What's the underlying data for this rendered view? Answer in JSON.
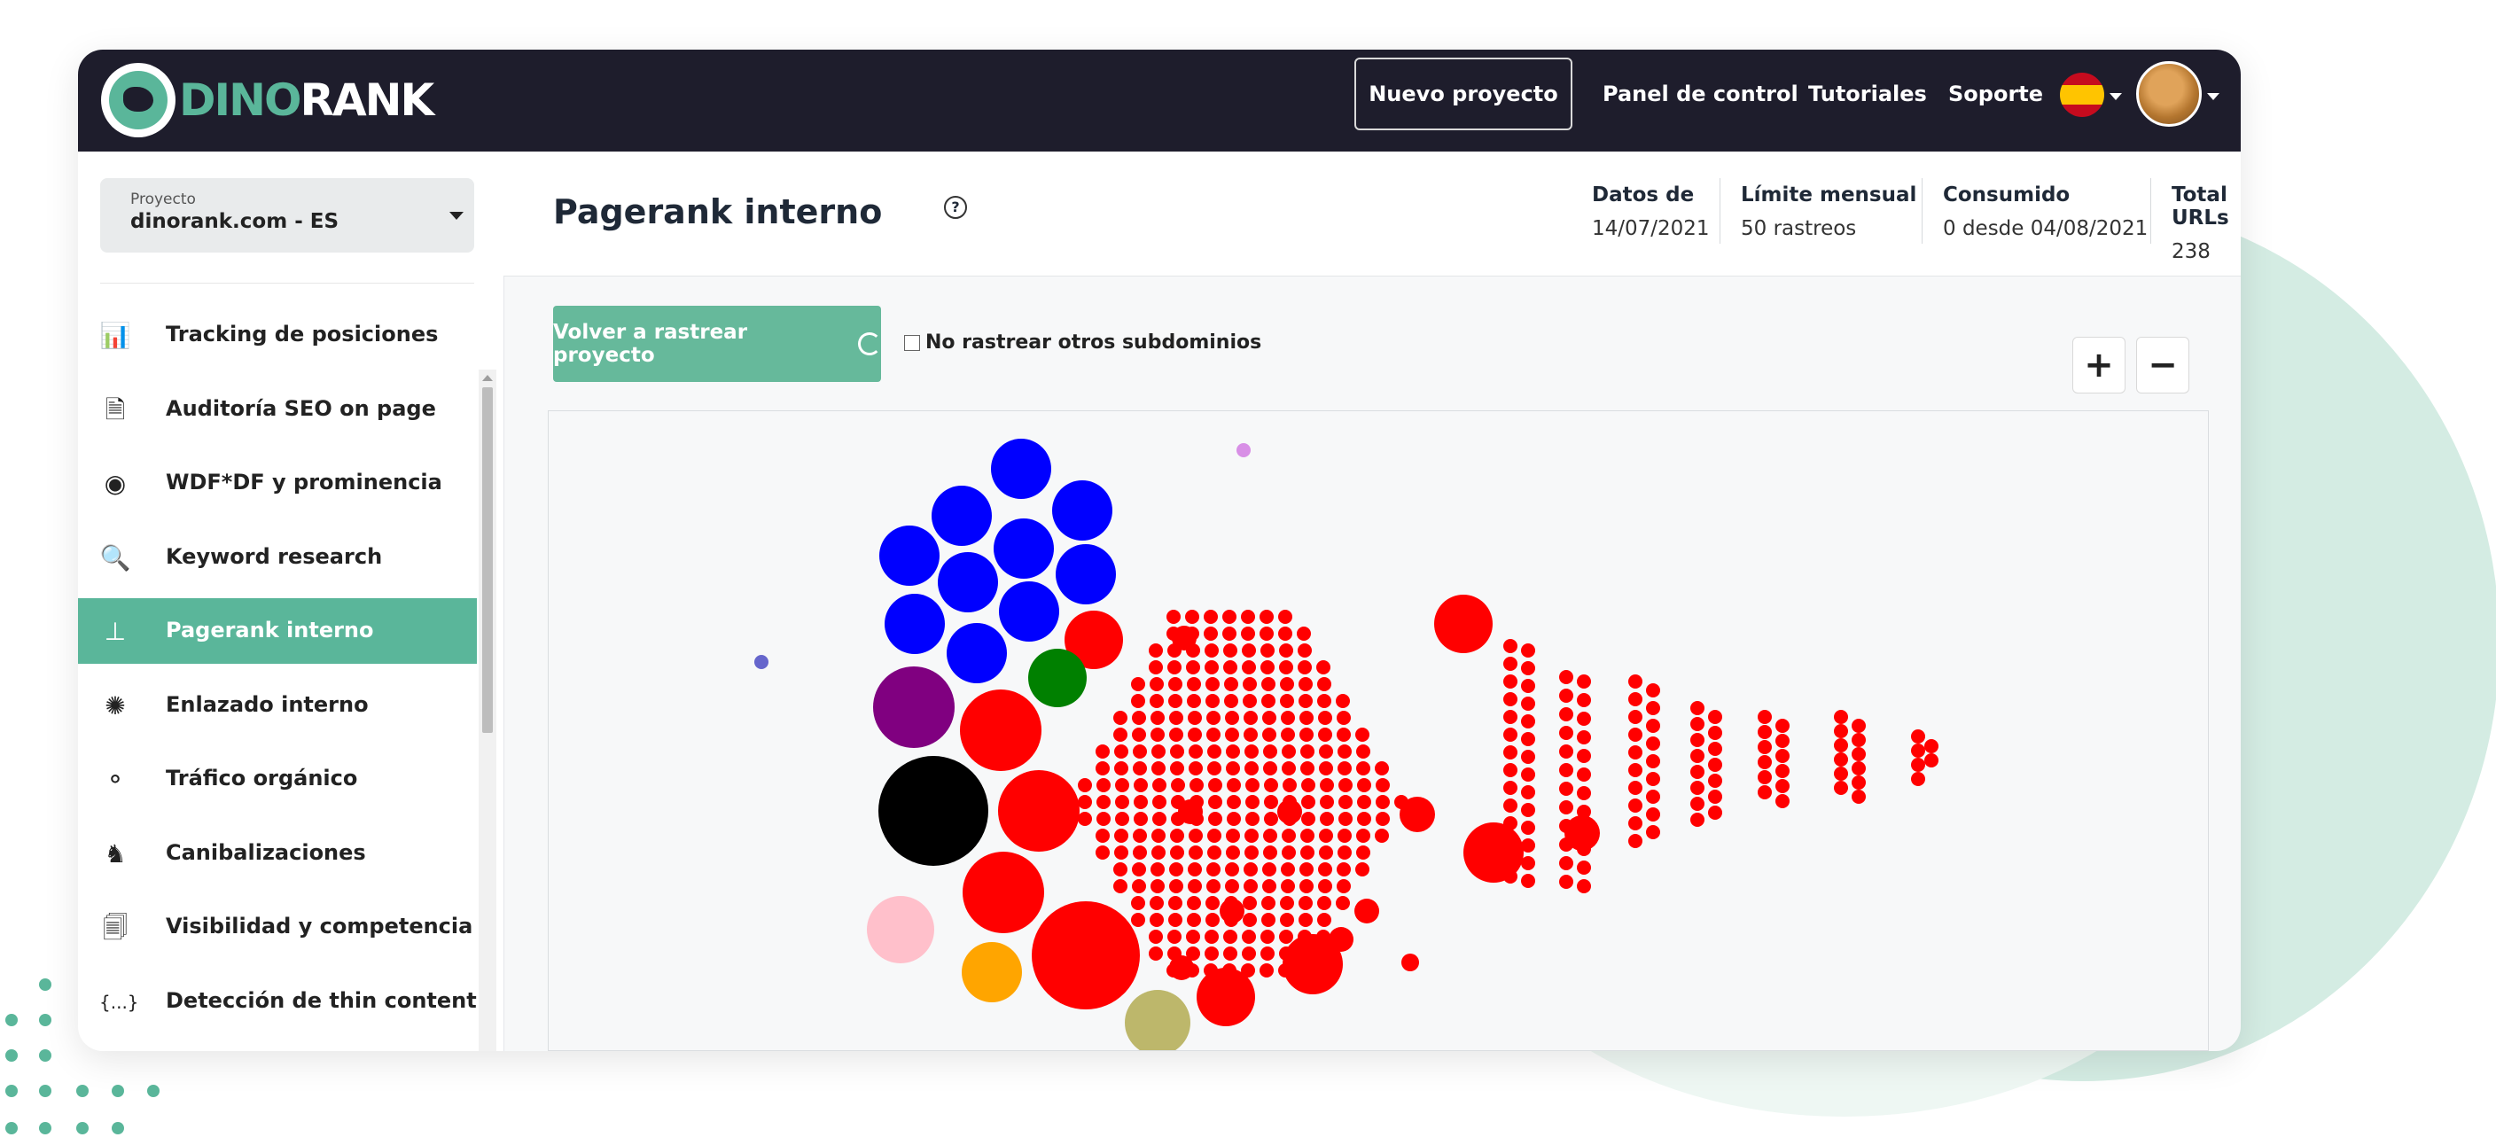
{
  "brand": {
    "name_part1": "DINO",
    "name_part2": "RANK",
    "accent": "#5ab69a",
    "dark": "#1e1d2c"
  },
  "nav": {
    "new_project": "Nuevo proyecto",
    "dashboard": "Panel de control",
    "tutorials": "Tutoriales",
    "support": "Soporte",
    "language_icon": "spain-flag-icon",
    "avatar_icon": "user-avatar"
  },
  "project": {
    "label": "Proyecto",
    "value": "dinorank.com - ES"
  },
  "sidebar": {
    "items": [
      {
        "label": "Tracking de posiciones",
        "icon": "bar-chart-icon",
        "glyph": "📊"
      },
      {
        "label": "Auditoría SEO on page",
        "icon": "document-chart-icon",
        "glyph": "🗎"
      },
      {
        "label": "WDF*DF y prominencia",
        "icon": "target-icon",
        "glyph": "◉"
      },
      {
        "label": "Keyword research",
        "icon": "keyword-search-icon",
        "glyph": "🔍"
      },
      {
        "label": "Pagerank interno",
        "icon": "hierarchy-icon",
        "glyph": "⊥",
        "active": true
      },
      {
        "label": "Enlazado interno",
        "icon": "network-icon",
        "glyph": "✺"
      },
      {
        "label": "Tráfico orgánico",
        "icon": "traffic-light-icon",
        "glyph": "⚬"
      },
      {
        "label": "Canibalizaciones",
        "icon": "dino-icon",
        "glyph": "♞"
      },
      {
        "label": "Visibilidad y competencia",
        "icon": "document-eye-icon",
        "glyph": "🗐"
      },
      {
        "label": "Detección de thin content",
        "icon": "braces-icon",
        "glyph": "{...}"
      }
    ]
  },
  "page": {
    "title": "Pagerank interno",
    "help_icon": "question-icon"
  },
  "stats": [
    {
      "label": "Datos de",
      "value": "14/07/2021"
    },
    {
      "label": "Límite mensual",
      "value": "50 rastreos"
    },
    {
      "label": "Consumido",
      "value": "0 desde 04/08/2021"
    },
    {
      "label": "Total URLs",
      "value": "238"
    }
  ],
  "actions": {
    "recrawl": "Volver a rastrear proyecto",
    "no_subdomains": "No rastrear otros subdominios",
    "zoom_in": "+",
    "zoom_out": "−"
  },
  "graph": {
    "node_colors": {
      "blue": "#0000ff",
      "red": "#ff0000",
      "green": "#008000",
      "purple": "#800080",
      "black": "#000000",
      "pink": "#ffc0cb",
      "orange": "#ffa500",
      "olive": "#bdb76b",
      "violet": "#d88fe6",
      "slate": "#6666cc"
    }
  }
}
